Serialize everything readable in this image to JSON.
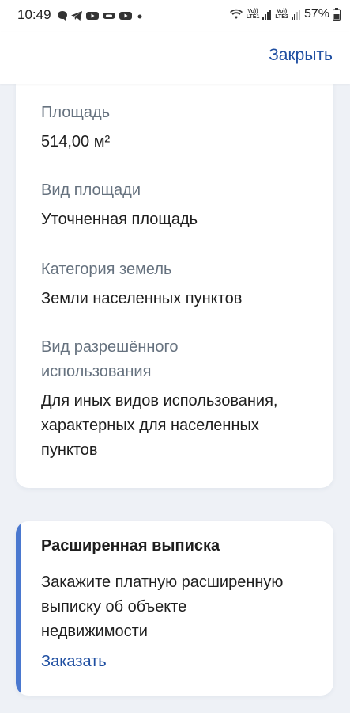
{
  "status_bar": {
    "time": "10:49",
    "battery": "57%",
    "network": {
      "sim1_top": "Vo))",
      "sim1_bottom": "LTE1",
      "sim2_top": "Vo))",
      "sim2_bottom": "LTE2"
    },
    "icons_left": [
      "chat-bubble-icon",
      "telegram-icon",
      "youtube-icon",
      "link-icon",
      "youtube-icon",
      "dot-icon"
    ]
  },
  "header": {
    "close_label": "Закрыть"
  },
  "info_card": {
    "fields": [
      {
        "label": "Площадь",
        "value": "514,00 м²"
      },
      {
        "label": "Вид площади",
        "value": "Уточненная площадь"
      },
      {
        "label": "Категория земель",
        "value": "Земли населенных пунктов"
      },
      {
        "label_line1": "Вид разрешённого",
        "label_line2": "использования",
        "value_line1": "Для иных видов использования,",
        "value_line2": "характерных для населенных",
        "value_line3": "пунктов"
      }
    ]
  },
  "extract_card": {
    "title": "Расширенная выписка",
    "desc_line1": "Закажите платную расширенную",
    "desc_line2": "выписку об объекте",
    "desc_line3": "недвижимости",
    "action_label": "Заказать"
  },
  "colors": {
    "accent": "#1e4ea1",
    "accent_bar": "#4a78cf",
    "background": "#eef1f6",
    "label_gray": "#66727f"
  }
}
